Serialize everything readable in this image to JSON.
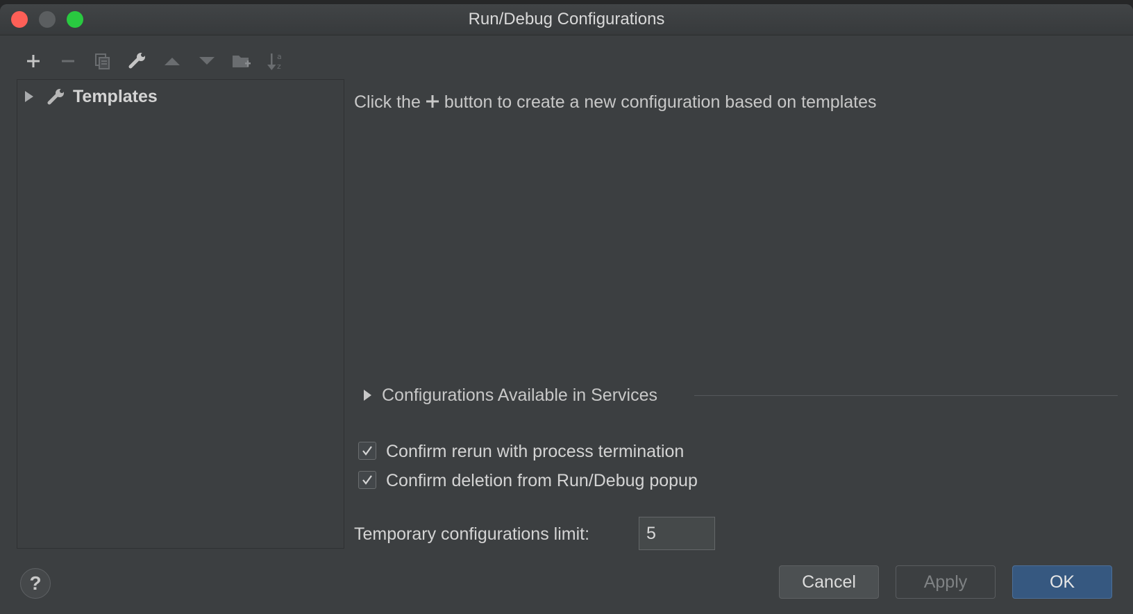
{
  "window": {
    "title": "Run/Debug Configurations"
  },
  "toolbar": {
    "buttons": [
      {
        "name": "add-icon",
        "enabled": true
      },
      {
        "name": "remove-icon",
        "enabled": false
      },
      {
        "name": "copy-icon",
        "enabled": false
      },
      {
        "name": "wrench-icon",
        "enabled": true
      },
      {
        "name": "move-up-icon",
        "enabled": false
      },
      {
        "name": "move-down-icon",
        "enabled": false
      },
      {
        "name": "new-folder-icon",
        "enabled": false
      },
      {
        "name": "sort-alphabetically-icon",
        "enabled": false
      }
    ]
  },
  "tree": {
    "items": [
      {
        "label": "Templates",
        "icon": "wrench-icon",
        "expanded": false
      }
    ]
  },
  "main": {
    "hint_before": "Click the",
    "hint_after": "button to create a new configuration based on templates",
    "services_section": {
      "label": "Configurations Available in Services",
      "expanded": false
    },
    "options": [
      {
        "label": "Confirm rerun with process termination",
        "checked": true
      },
      {
        "label": "Confirm deletion from Run/Debug popup",
        "checked": true
      }
    ],
    "temp_limit": {
      "label": "Temporary configurations limit:",
      "value": "5"
    }
  },
  "footer": {
    "help_label": "?",
    "cancel_label": "Cancel",
    "apply_label": "Apply",
    "ok_label": "OK"
  },
  "colors": {
    "background": "#3c3f41",
    "ok_button": "#365880",
    "close_traffic": "#fe5f57",
    "maximize_traffic": "#29c940"
  }
}
